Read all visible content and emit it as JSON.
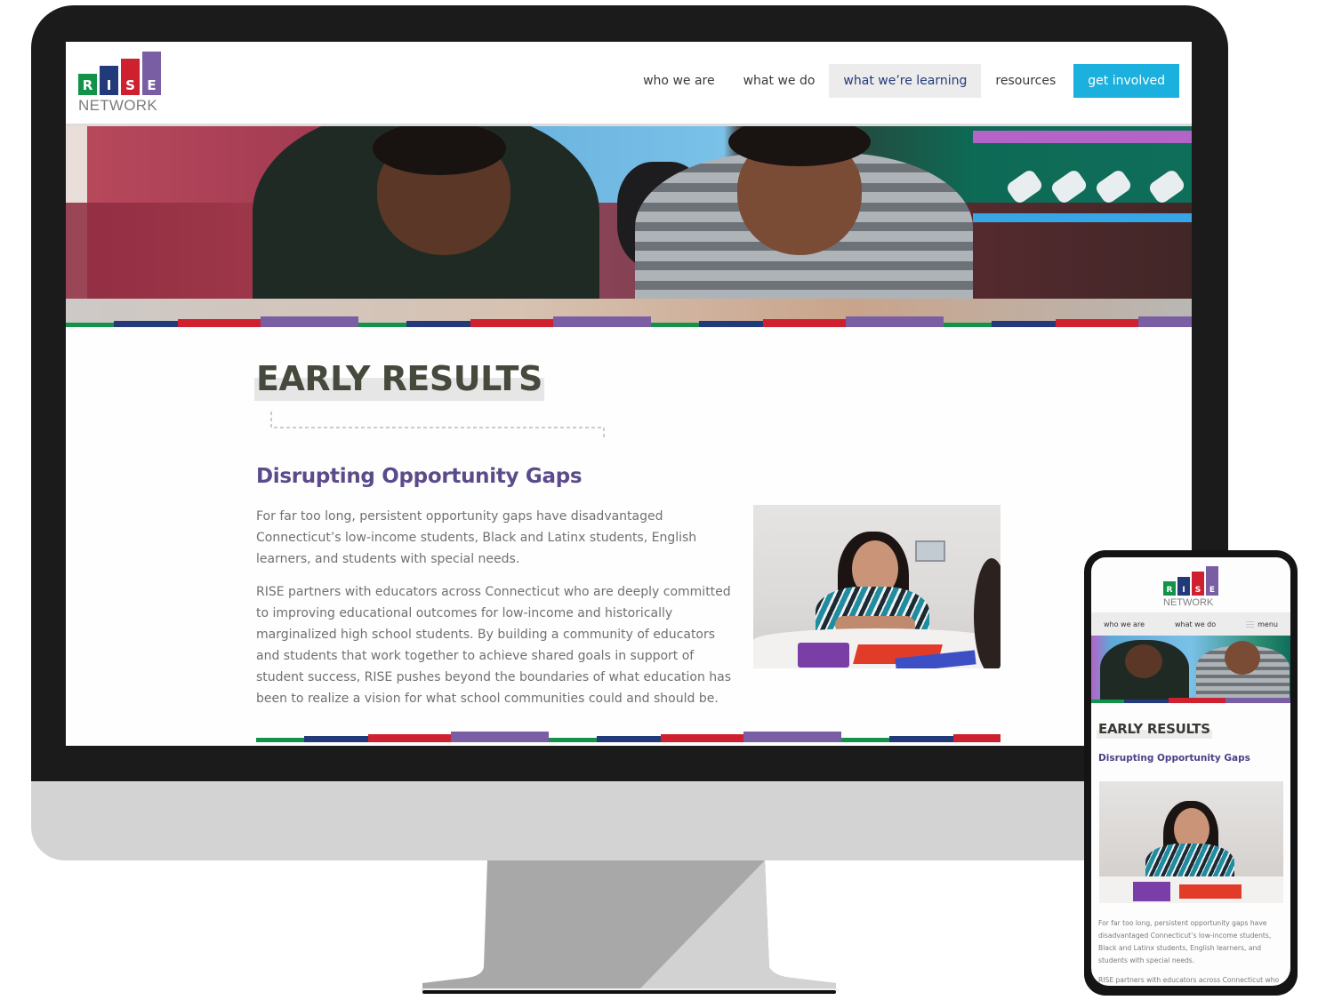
{
  "brand": {
    "logo_letters": [
      "R",
      "I",
      "S",
      "E"
    ],
    "logo_subtitle": "NETWORK",
    "colors": {
      "green": "#13924a",
      "navy": "#233a7a",
      "red": "#cf202f",
      "purple": "#7a5ea3",
      "cta_blue": "#1bb0de",
      "heading_purple": "#5b4b8a",
      "title_dark": "#464a3d",
      "body_gray": "#707070"
    }
  },
  "desktop": {
    "nav": {
      "items": [
        {
          "label": "who we are",
          "active": false
        },
        {
          "label": "what we do",
          "active": false
        },
        {
          "label": "what we’re learning",
          "active": true
        },
        {
          "label": "resources",
          "active": false
        }
      ],
      "cta_label": "get involved"
    },
    "hero_image": "students-writing-at-desk",
    "page_title": "EARLY RESULTS",
    "section_heading": "Disrupting Opportunity Gaps",
    "paragraphs": [
      "For far too long, persistent opportunity gaps have disadvantaged Connecticut’s low-income students, Black and Latinx students, English learners, and students with special needs.",
      "RISE partners with educators across Connecticut who are deeply committed to improving educational outcomes for low-income and historically marginalized high school students. By building a community of educators and students that work together to achieve shared goals in support of student success, RISE pushes beyond the boundaries of what education has been to realize a vision for what school communities could and should be."
    ],
    "side_image": "student-smiling-at-table"
  },
  "mobile": {
    "nav": {
      "items": [
        "who we are",
        "what we do"
      ],
      "menu_label": "menu",
      "menu_icon": "hamburger-icon"
    },
    "page_title": "EARLY RESULTS",
    "section_heading": "Disrupting Opportunity Gaps",
    "paragraphs": [
      "For far too long, persistent opportunity gaps have disadvantaged Connecticut’s low-income students, Black and Latinx students, English learners, and students with special needs.",
      "RISE partners with educators across Connecticut who are deeply committed to improving educational"
    ]
  }
}
